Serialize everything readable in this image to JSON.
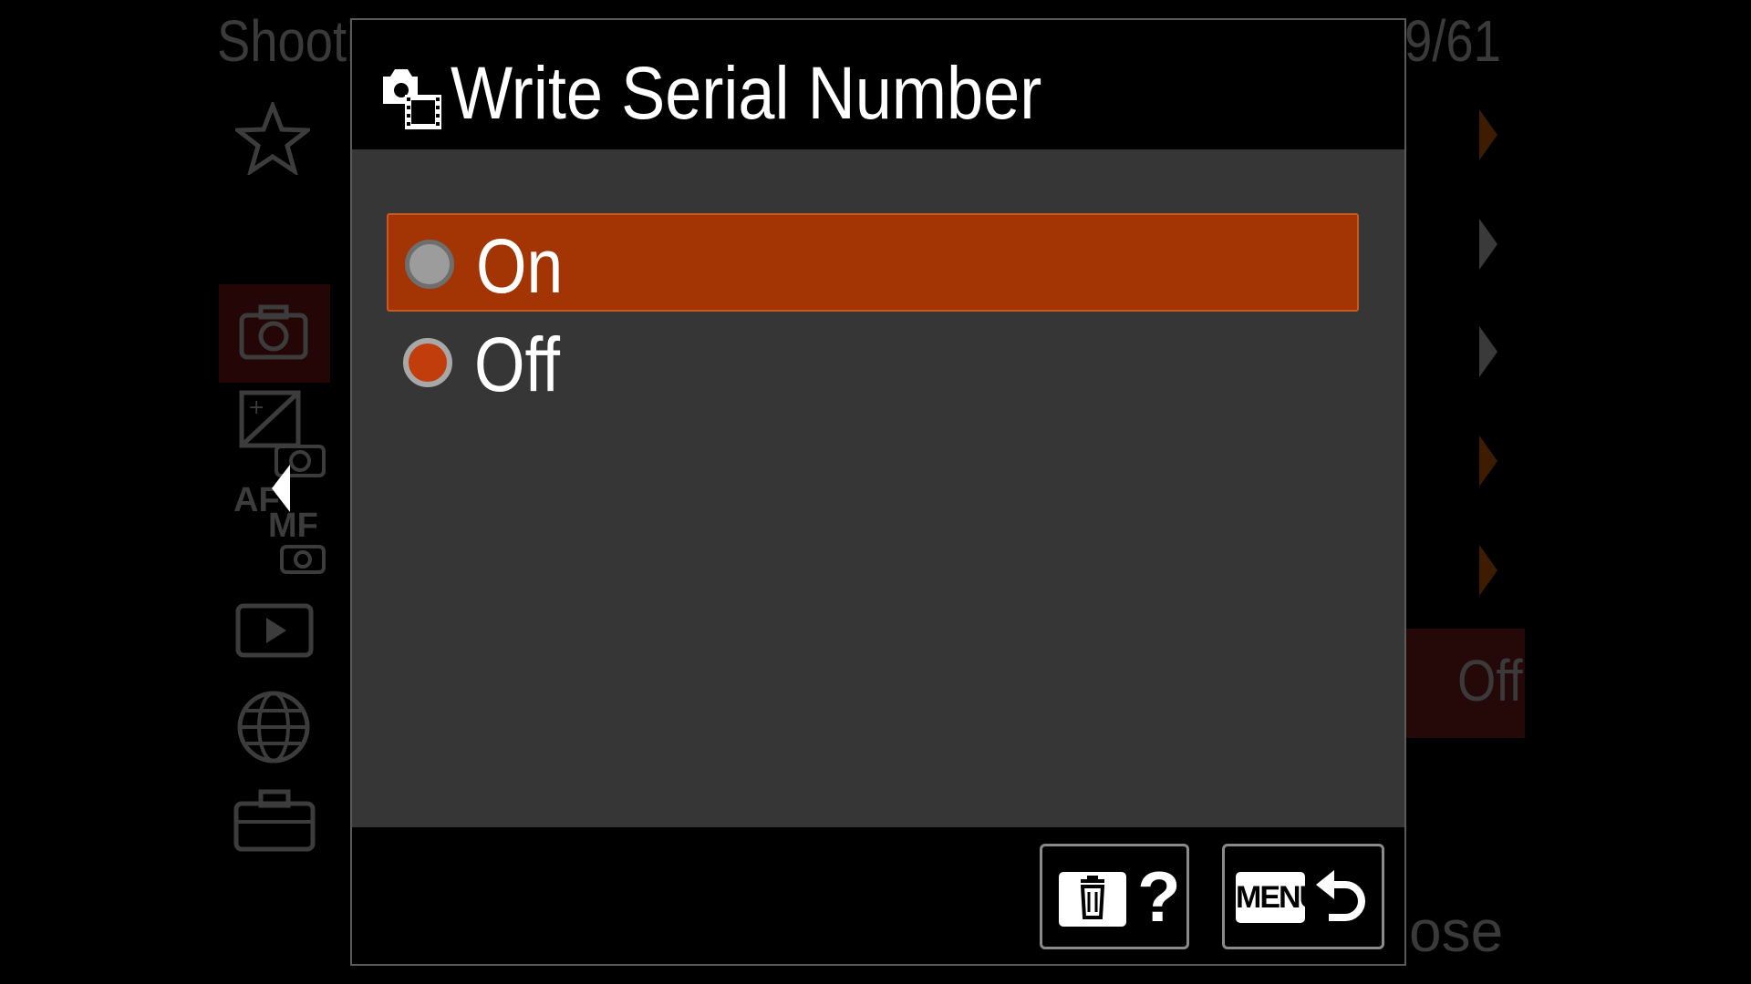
{
  "background_menu": {
    "title": "Shooti",
    "page_indicator": "9/61",
    "highlighted_value": "Off",
    "bottom_text": "ose",
    "side_tabs": [
      "star-icon",
      "camera-icon",
      "exposure-icon",
      "af-mf-icon",
      "playback-icon",
      "globe-icon",
      "toolbox-icon"
    ],
    "side_labels": {
      "af": "AF",
      "mf": "MF"
    }
  },
  "dialog": {
    "title": "Write Serial Number",
    "title_icon": "still-movie-icon",
    "options": [
      {
        "label": "On",
        "state": "focused"
      },
      {
        "label": "Off",
        "state": "selected"
      }
    ],
    "footer": {
      "help_symbol": "?",
      "menu_label": "MENU"
    }
  },
  "colors": {
    "focus_highlight": "#a33505",
    "radio_selected": "#c23d0c",
    "body_bg": "#363636"
  }
}
